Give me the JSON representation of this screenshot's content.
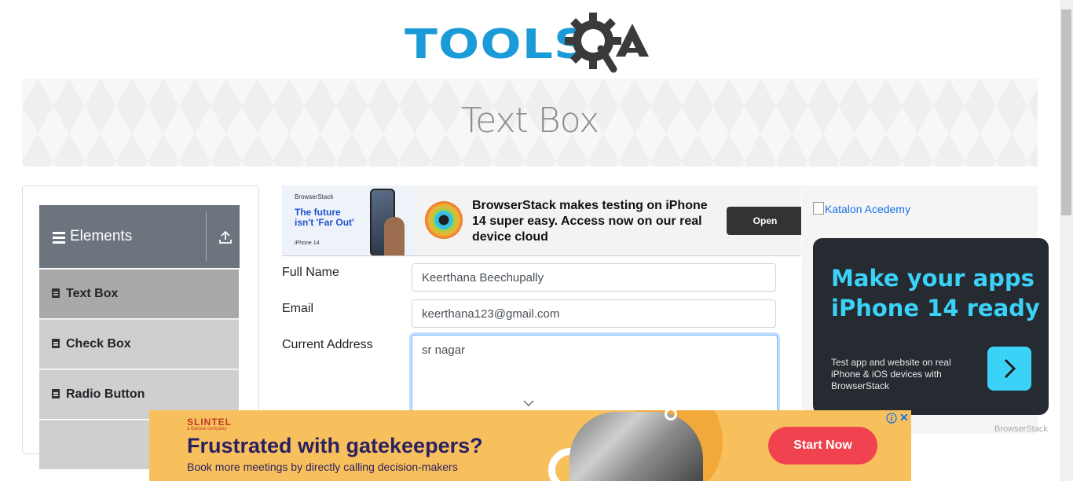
{
  "logo": {
    "text": "TOOLS",
    "suffix": "QA"
  },
  "banner": {
    "title": "Text Box"
  },
  "sidebar": {
    "group_label": "Elements",
    "items": [
      {
        "label": "Text Box",
        "active": true
      },
      {
        "label": "Check Box",
        "active": false
      },
      {
        "label": "Radio Button",
        "active": false
      }
    ]
  },
  "top_ad": {
    "logo": "BrowserStack",
    "left_headline": "The future isn't 'Far Out'",
    "left_product": "iPhone 14",
    "message": "BrowserStack makes testing on iPhone 14 super easy. Access now on our real device cloud",
    "button": "Open"
  },
  "form": {
    "full_name": {
      "label": "Full Name",
      "value": "Keerthana Beechupally"
    },
    "email": {
      "label": "Email",
      "value": "keerthana123@gmail.com"
    },
    "current_address": {
      "label": "Current Address",
      "value": "sr nagar"
    }
  },
  "right_ad": {
    "image_alt": "Katalon Acedemy",
    "headline": "Make your apps iPhone 14 ready",
    "sub": "Test app and website on real iPhone & iOS devices with BrowserStack",
    "footer": "BrowserStack"
  },
  "bottom_ad": {
    "brand": "SLINTEL",
    "brand_sub": "a 6sense company",
    "headline": "Frustrated with gatekeepers?",
    "sub": "Book more meetings by directly calling decision-makers",
    "button": "Start Now",
    "close": "✕"
  },
  "colors": {
    "logo_blue": "#1a9bd7",
    "logo_dark": "#3a3a3a",
    "accent_cyan": "#3ad2f7",
    "cta_red": "#f0424f"
  }
}
